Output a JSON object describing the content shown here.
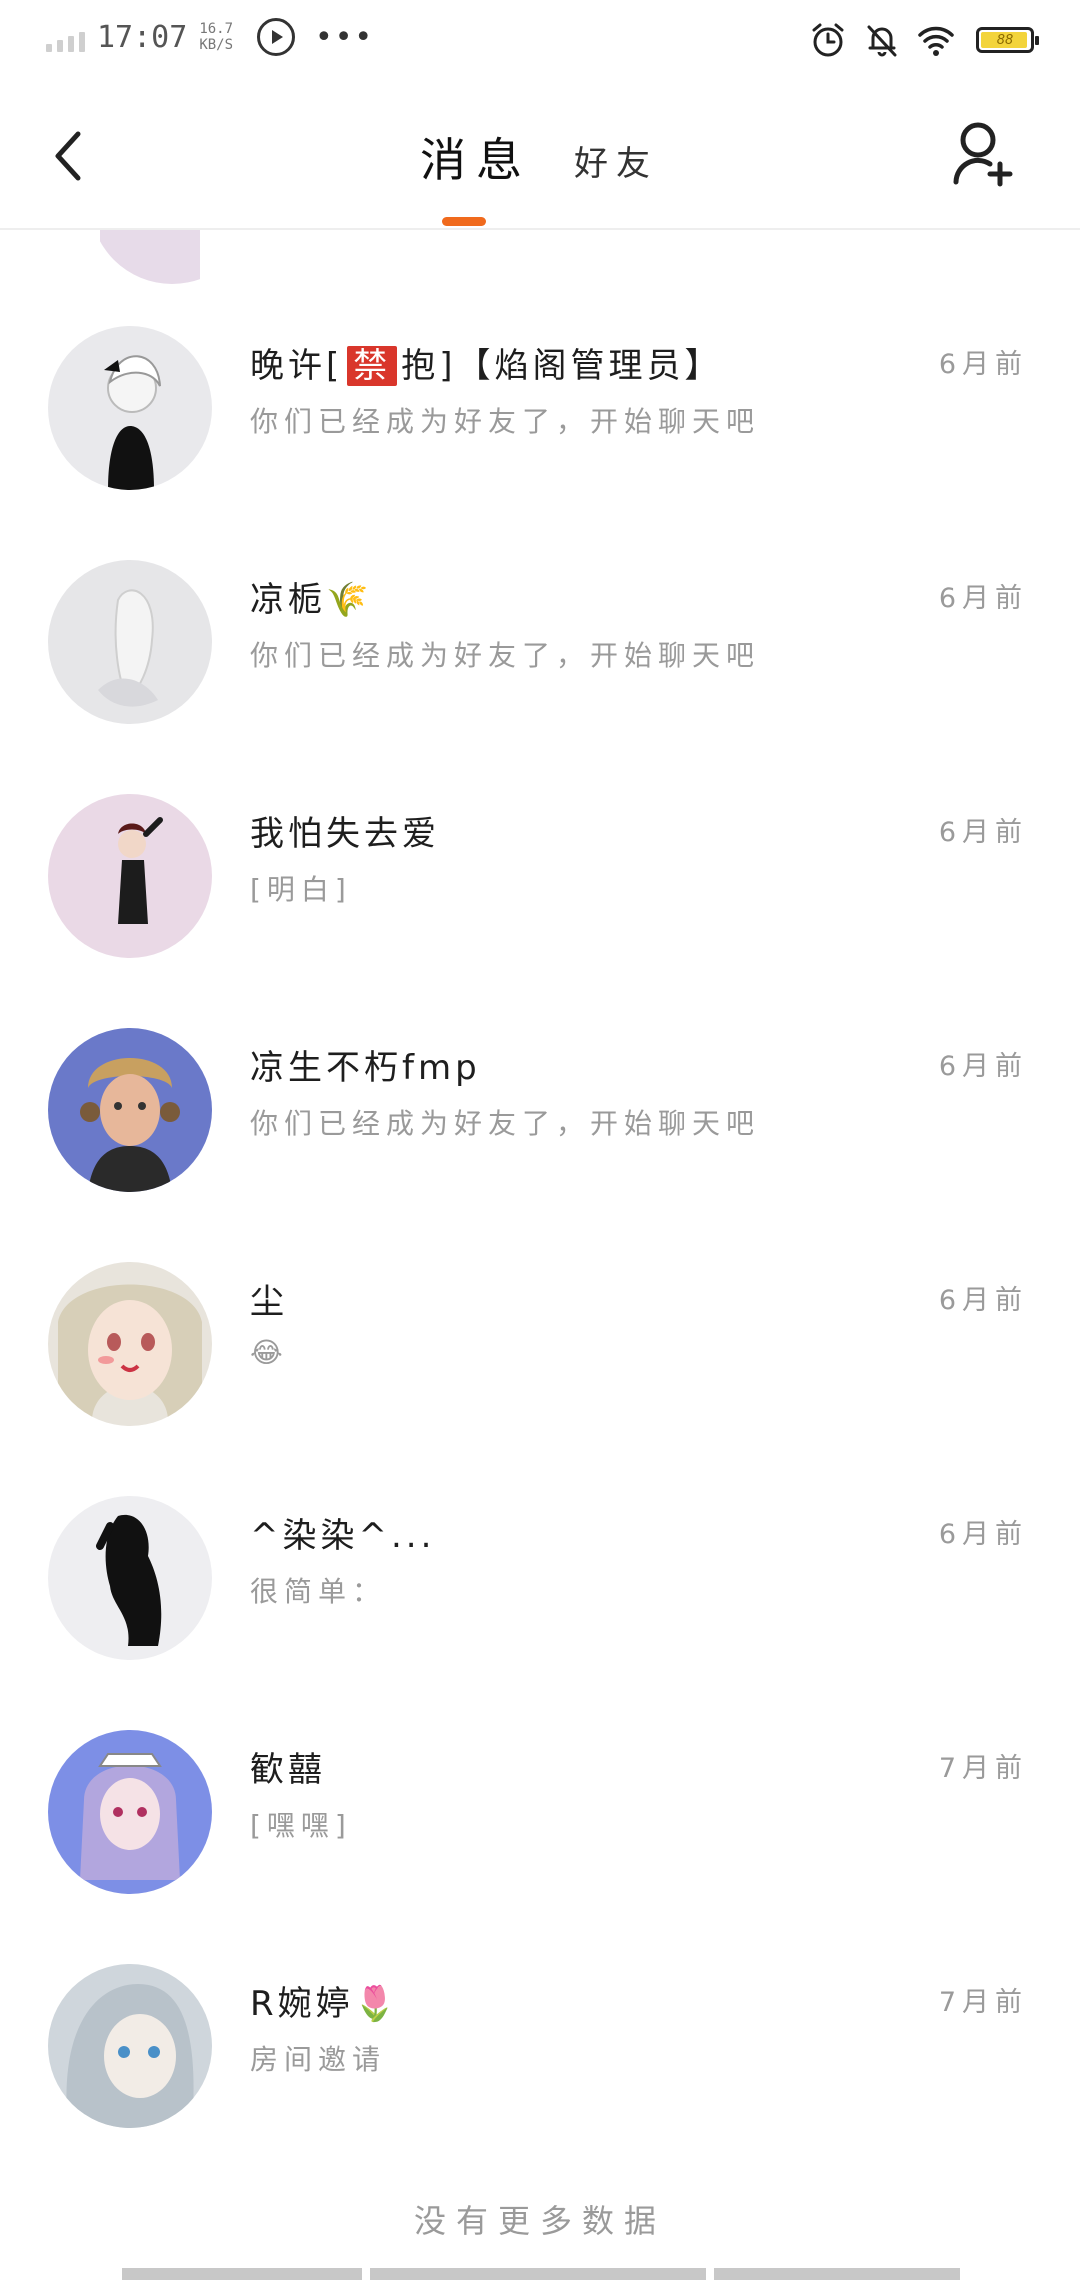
{
  "status_bar": {
    "time": "17:07",
    "net_speed_value": "16.7",
    "net_speed_unit": "KB/S",
    "more": "•••",
    "battery_level": "88"
  },
  "header": {
    "tabs": [
      {
        "label": "消息",
        "active": true
      },
      {
        "label": "好友",
        "active": false
      }
    ],
    "accent_color": "#f06a1d"
  },
  "conversations": [
    {
      "name_pre": "晚许[",
      "name_tag": "禁",
      "name_post": "抱]【焰阁管理员】",
      "preview": "你们已经成为好友了，开始聊天吧",
      "time": "6月前"
    },
    {
      "name_pre": "凉栀🌾",
      "name_tag": "",
      "name_post": "",
      "preview": "你们已经成为好友了，开始聊天吧",
      "time": "6月前"
    },
    {
      "name_pre": "我怕失去爱",
      "name_tag": "",
      "name_post": "",
      "preview": "[明白]",
      "time": "6月前"
    },
    {
      "name_pre": "凉生不朽fmp",
      "name_tag": "",
      "name_post": "",
      "preview": "你们已经成为好友了，开始聊天吧",
      "time": "6月前"
    },
    {
      "name_pre": "尘",
      "name_tag": "",
      "name_post": "",
      "preview": "😂",
      "time": "6月前"
    },
    {
      "name_pre": "^染染^...",
      "name_tag": "",
      "name_post": "",
      "preview": "很简单：",
      "time": "6月前"
    },
    {
      "name_pre": "歓囍",
      "name_tag": "",
      "name_post": "",
      "preview": "[嘿嘿]",
      "time": "7月前"
    },
    {
      "name_pre": "R婉婷🌷",
      "name_tag": "",
      "name_post": "",
      "preview": "房间邀请",
      "time": "7月前"
    }
  ],
  "footer": {
    "no_more": "没有更多数据"
  }
}
